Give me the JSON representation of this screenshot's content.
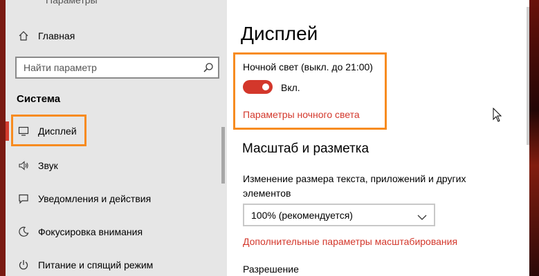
{
  "sidebar": {
    "top_partial": "Параметры",
    "home": "Главная",
    "search_placeholder": "Найти параметр",
    "section_title": "Система",
    "items": [
      {
        "label": "Дисплей",
        "icon": "monitor-icon",
        "active": true
      },
      {
        "label": "Звук",
        "icon": "speaker-icon"
      },
      {
        "label": "Уведомления и действия",
        "icon": "notification-icon"
      },
      {
        "label": "Фокусировка внимания",
        "icon": "moon-icon"
      },
      {
        "label": "Питание и спящий режим",
        "icon": "power-icon"
      }
    ]
  },
  "main": {
    "title": "Дисплей",
    "night_light_label": "Ночной свет (выкл. до 21:00)",
    "toggle_state": "Вкл.",
    "night_light_link": "Параметры ночного света",
    "scale_section": "Масштаб и разметка",
    "scale_description": "Изменение размера текста, приложений и других элементов",
    "scale_value": "100% (рекомендуется)",
    "advanced_scale_link": "Дополнительные параметры масштабирования",
    "resolution_label": "Разрешение"
  },
  "colors": {
    "accent": "#d3372b",
    "highlight": "#f78b1f",
    "sidebar_bg": "#e6e6e6"
  }
}
